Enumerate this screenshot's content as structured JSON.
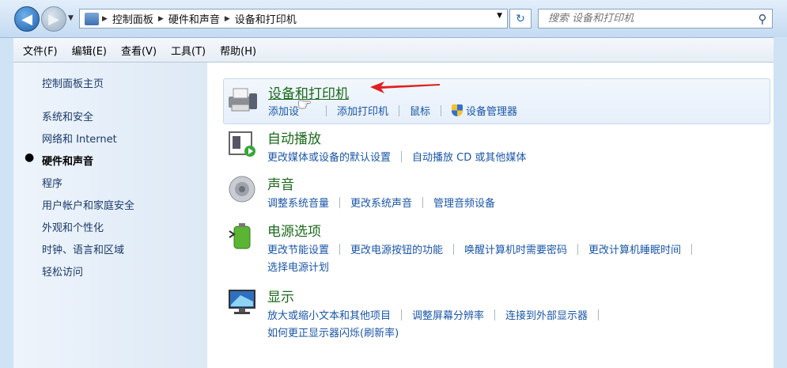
{
  "addressbar": {
    "crumbs": [
      "控制面板",
      "硬件和声音",
      "设备和打印机"
    ],
    "search_placeholder": "搜索 设备和打印机"
  },
  "menubar": [
    "文件(F)",
    "编辑(E)",
    "查看(V)",
    "工具(T)",
    "帮助(H)"
  ],
  "sidebar": {
    "home": "控制面板主页",
    "items": [
      "系统和安全",
      "网络和 Internet",
      "硬件和声音",
      "程序",
      "用户帐户和家庭安全",
      "外观和个性化",
      "时钟、语言和区域",
      "轻松访问"
    ],
    "active_index": 2
  },
  "categories": [
    {
      "title": "设备和打印机",
      "icon": "printer-icon",
      "links": [
        "添加设",
        "添加打印机",
        "鼠标",
        "设备管理器"
      ]
    },
    {
      "title": "自动播放",
      "icon": "autoplay-icon",
      "links": [
        "更改媒体或设备的默认设置",
        "自动播放 CD 或其他媒体"
      ]
    },
    {
      "title": "声音",
      "icon": "speaker-icon",
      "links": [
        "调整系统音量",
        "更改系统声音",
        "管理音频设备"
      ]
    },
    {
      "title": "电源选项",
      "icon": "battery-icon",
      "links": [
        "更改节能设置",
        "更改电源按钮的功能",
        "唤醒计算机时需要密码",
        "更改计算机睡眠时间"
      ],
      "links2": [
        "选择电源计划"
      ]
    },
    {
      "title": "显示",
      "icon": "monitor-icon",
      "links": [
        "放大或缩小文本和其他项目",
        "调整屏幕分辨率",
        "连接到外部显示器"
      ],
      "links2": [
        "如何更正显示器闪烁(刷新率)"
      ]
    }
  ],
  "colors": {
    "title_green": "#1b6a1b",
    "link_blue": "#1a56a8",
    "arrow_red": "#e02020"
  }
}
